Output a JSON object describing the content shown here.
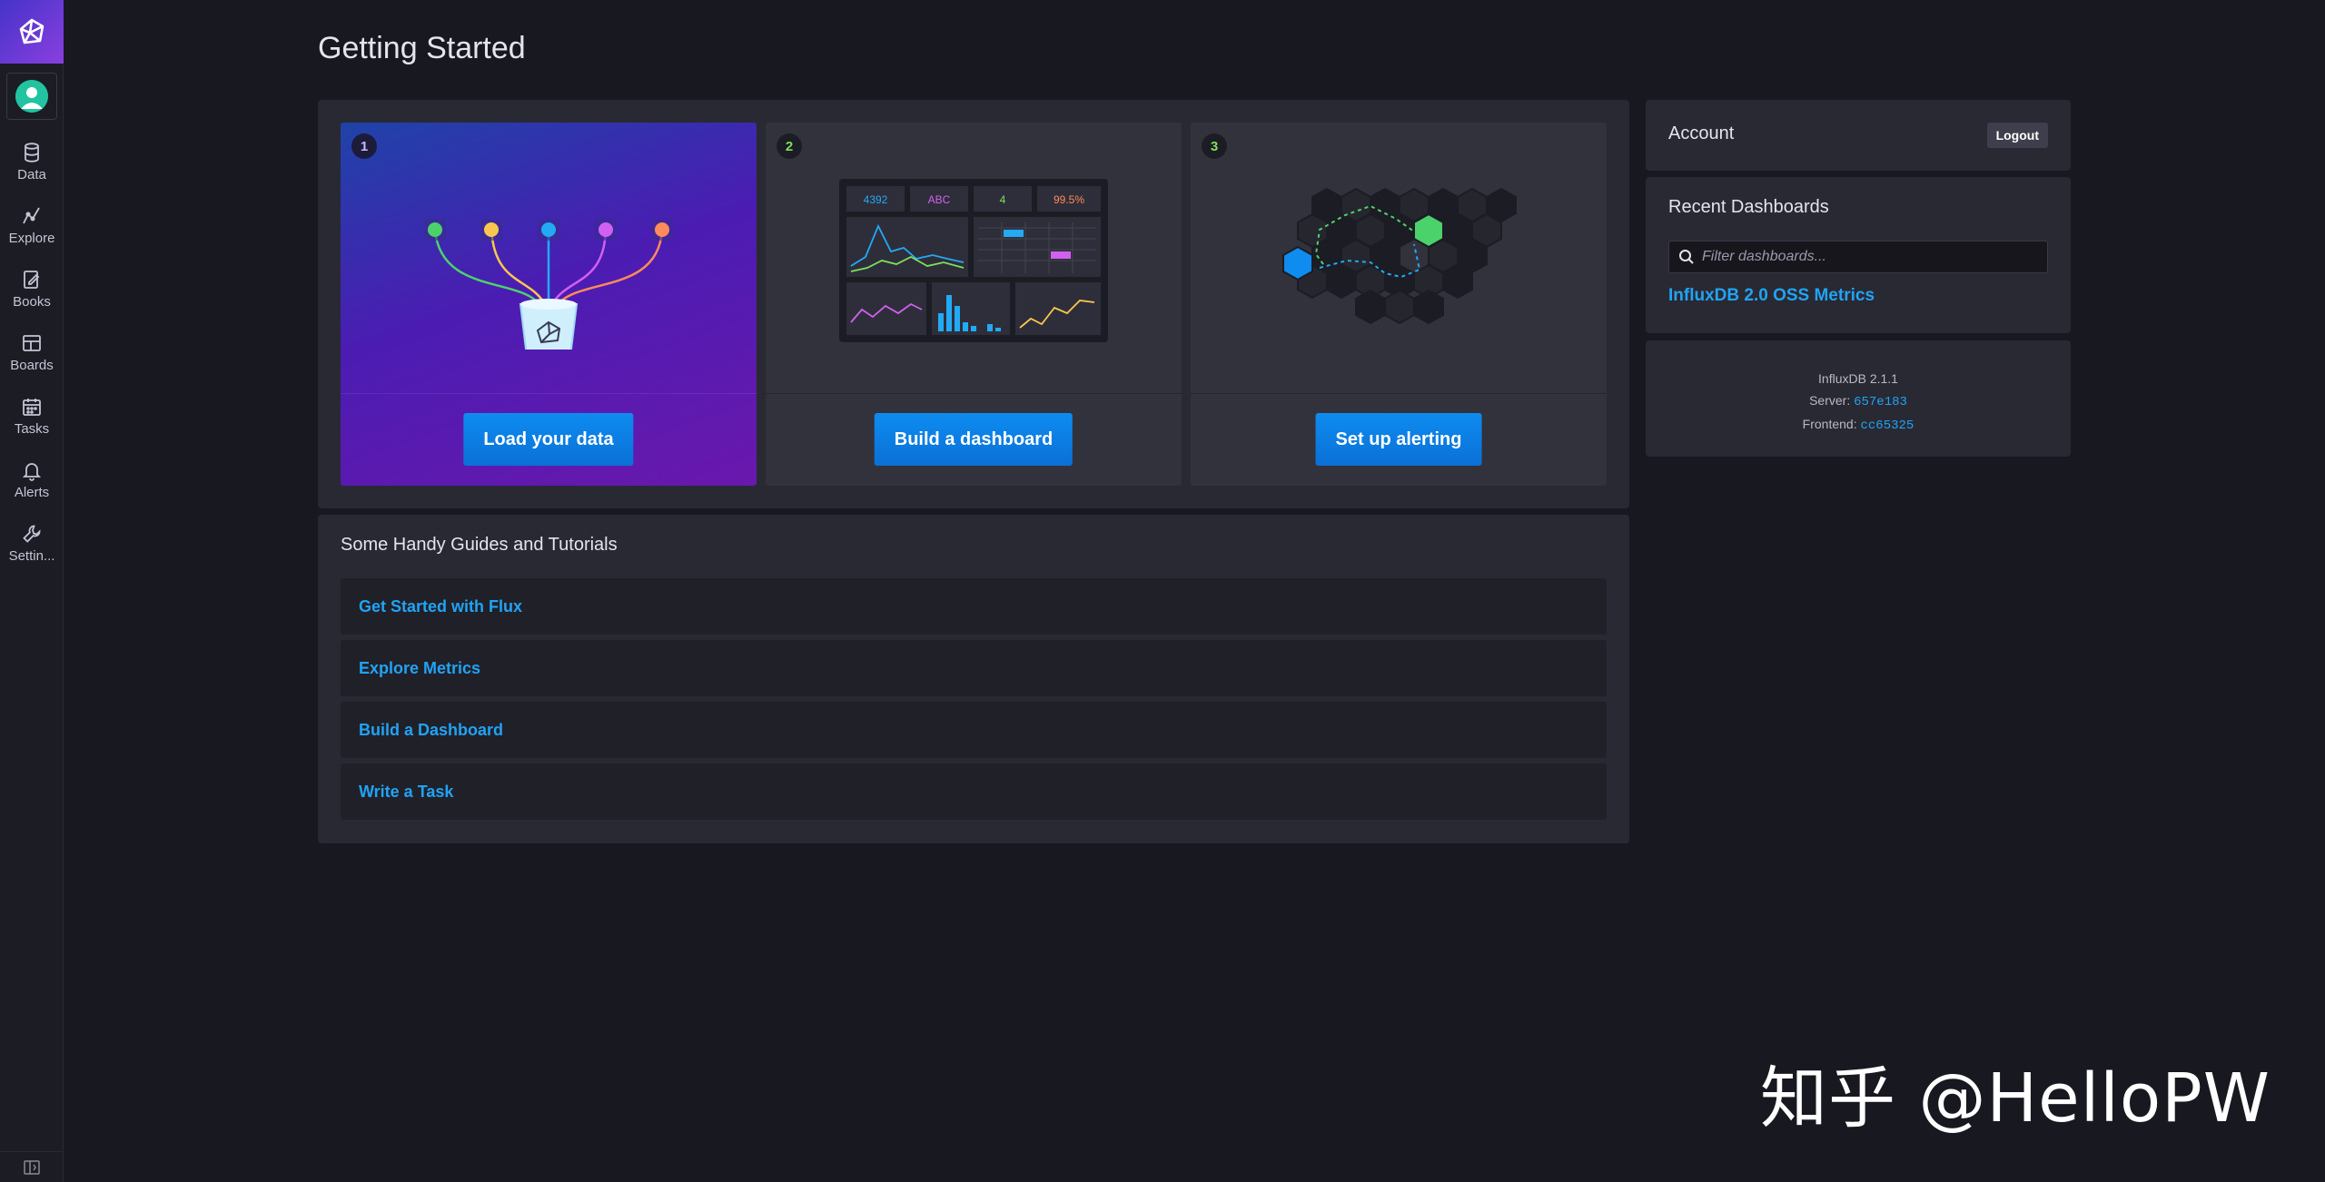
{
  "sidebar": {
    "logo_icon": "influxdb-logo-icon",
    "avatar_icon": "user-avatar-icon",
    "items": [
      {
        "label": "Data",
        "icon": "database-icon"
      },
      {
        "label": "Explore",
        "icon": "graph-line-icon"
      },
      {
        "label": "Books",
        "icon": "notebook-icon"
      },
      {
        "label": "Boards",
        "icon": "dashboard-grid-icon"
      },
      {
        "label": "Tasks",
        "icon": "calendar-icon"
      },
      {
        "label": "Alerts",
        "icon": "bell-icon"
      },
      {
        "label": "Settin...",
        "icon": "wrench-icon"
      }
    ],
    "collapse_icon": "sidebar-collapse-icon"
  },
  "page": {
    "title": "Getting Started"
  },
  "steps": [
    {
      "number": "1",
      "button": "Load your data"
    },
    {
      "number": "2",
      "button": "Build a dashboard",
      "illustration_values": [
        "4392",
        "ABC",
        "4",
        "99.5%"
      ]
    },
    {
      "number": "3",
      "button": "Set up alerting"
    }
  ],
  "guides": {
    "title": "Some Handy Guides and Tutorials",
    "items": [
      "Get Started with Flux",
      "Explore Metrics",
      "Build a Dashboard",
      "Write a Task"
    ]
  },
  "account": {
    "title": "Account",
    "logout_label": "Logout"
  },
  "recent_dashboards": {
    "title": "Recent Dashboards",
    "filter_placeholder": "Filter dashboards...",
    "items": [
      "InfluxDB 2.0 OSS Metrics"
    ]
  },
  "version": {
    "product": "InfluxDB 2.1.1",
    "server_label": "Server:",
    "server_hash": "657e183",
    "frontend_label": "Frontend:",
    "frontend_hash": "cc65325"
  },
  "colors": {
    "accent": "#0e8cf0",
    "link": "#21a3f5",
    "step_number": "#7ee05a",
    "background": "#181820",
    "panel": "#292933"
  },
  "watermark": "知乎 @HelloPW"
}
